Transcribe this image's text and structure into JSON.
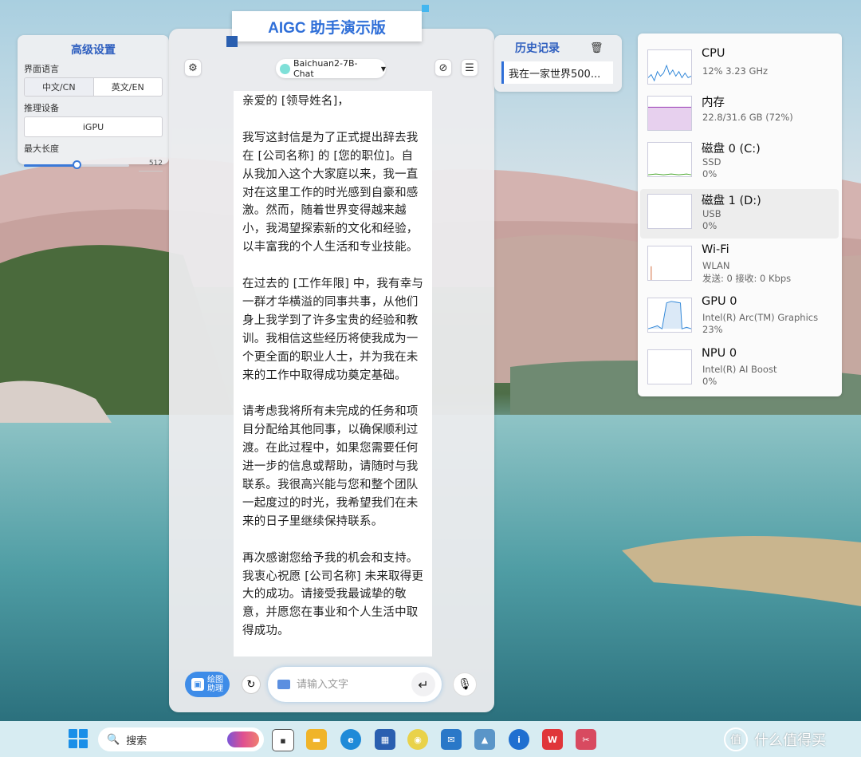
{
  "settings": {
    "title": "高级设置",
    "language_label": "界面语言",
    "lang_cn": "中文/CN",
    "lang_en": "英文/EN",
    "device_label": "推理设备",
    "device_value": "iGPU",
    "maxlen_label": "最大长度",
    "maxlen_value": "512",
    "maxlen_fraction": 0.5
  },
  "chat": {
    "banner": "AIGC 助手演示版",
    "model": "Baichuan2-7B-Chat",
    "document": "亲爱的 [领导姓名]，\n\n我写这封信是为了正式提出辞去我在 [公司名称] 的 [您的职位]。自从我加入这个大家庭以来，我一直对在这里工作的时光感到自豪和感激。然而，随着世界变得越来越小，我渴望探索新的文化和经验，以丰富我的个人生活和专业技能。\n\n在过去的 [工作年限] 中，我有幸与一群才华横溢的同事共事，从他们身上我学到了许多宝贵的经验和教训。我相信这些经历将使我成为一个更全面的职业人士，并为我在未来的工作中取得成功奠定基础。\n\n请考虑我将所有未完成的任务和项目分配给其他同事，以确保顺利过渡。在此过程中，如果您需要任何进一步的信息或帮助，请随时与我联系。我很高兴能与您和整个团队一起度过的时光，我希望我们在未来的日子里继续保持联系。\n\n再次感谢您给予我的机会和支持。我衷心祝愿 [公司名称] 未来取得更大的成功。请接受我最诚挚的敬意，并愿您在事业和个人生活中取得成功。",
    "draw_btn": "绘图\n助理",
    "input_placeholder": "请输入文字"
  },
  "history": {
    "title": "历史记录",
    "items": [
      "我在一家世界500..."
    ]
  },
  "perf": [
    {
      "name": "CPU",
      "sub1": "12%  3.23 GHz",
      "sub2": "",
      "color": "#2f86d8"
    },
    {
      "name": "内存",
      "sub1": "22.8/31.6 GB (72%)",
      "sub2": "",
      "color": "#9b40b6"
    },
    {
      "name": "磁盘 0 (C:)",
      "sub1": "SSD",
      "sub2": "0%",
      "color": "#4ca830"
    },
    {
      "name": "磁盘 1 (D:)",
      "sub1": "USB",
      "sub2": "0%",
      "color": "#4ca830"
    },
    {
      "name": "Wi-Fi",
      "sub1": "WLAN",
      "sub2": "发送: 0 接收: 0 Kbps",
      "color": "#d2693a"
    },
    {
      "name": "GPU 0",
      "sub1": "Intel(R) Arc(TM) Graphics",
      "sub2": "23%",
      "color": "#2f86d8"
    },
    {
      "name": "NPU 0",
      "sub1": "Intel(R) AI Boost",
      "sub2": "0%",
      "color": "#2f86d8"
    }
  ],
  "taskbar": {
    "search_placeholder": "搜索",
    "watermark": "什么值得买",
    "watermark_glyph": "值"
  }
}
